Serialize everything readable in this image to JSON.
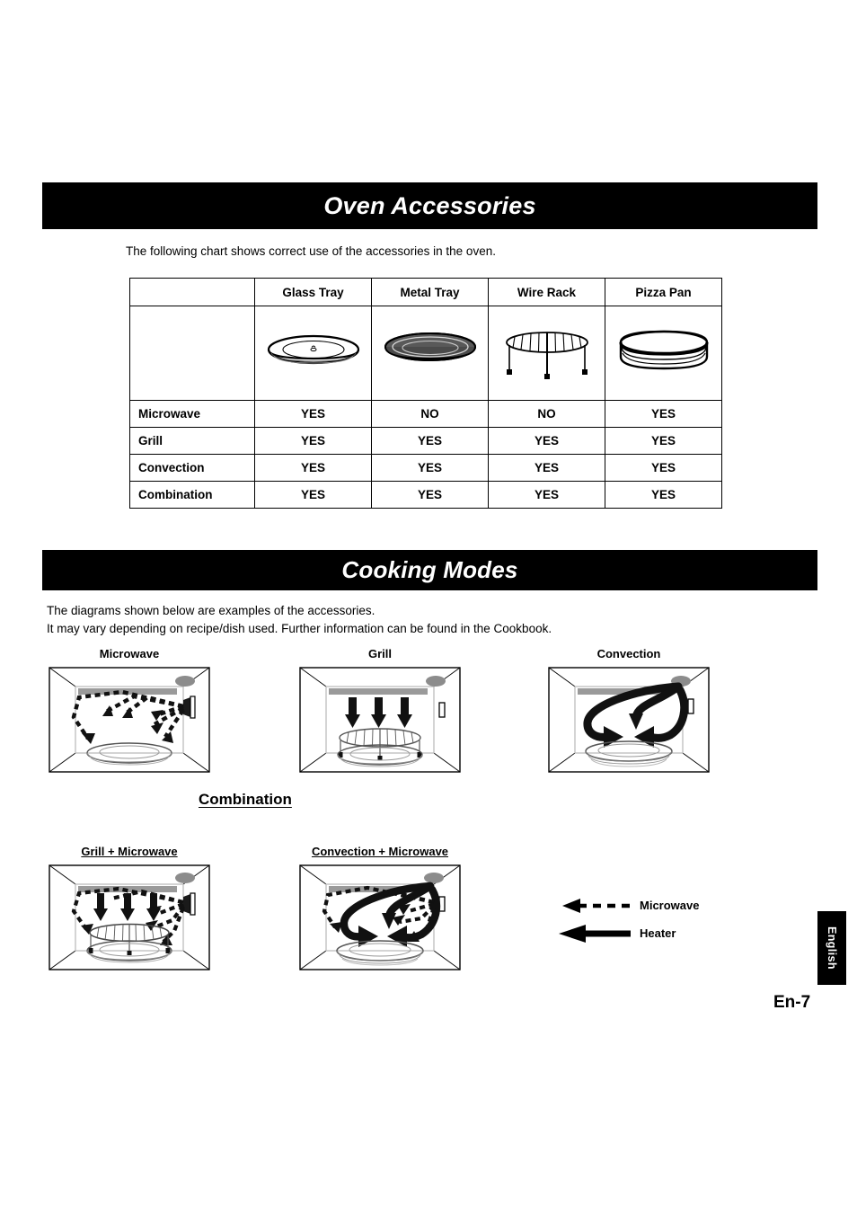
{
  "sections": {
    "accessories": {
      "title": "Oven Accessories",
      "intro": "The following chart shows correct use of the accessories in the oven."
    },
    "cooking": {
      "title": "Cooking Modes",
      "intro": "The diagrams shown below are examples of the accessories.\nIt may vary depending on recipe/dish used. Further information can be found in the Cookbook."
    }
  },
  "accessories_table": {
    "columns": [
      "",
      "Glass Tray",
      "Metal Tray",
      "Wire Rack",
      "Pizza Pan"
    ],
    "accessory_icons": [
      "glass-tray-icon",
      "metal-tray-icon",
      "wire-rack-icon",
      "pizza-pan-icon"
    ],
    "rows": [
      {
        "mode": "Microwave",
        "values": [
          "YES",
          "NO",
          "NO",
          "YES"
        ]
      },
      {
        "mode": "Grill",
        "values": [
          "YES",
          "YES",
          "YES",
          "YES"
        ]
      },
      {
        "mode": "Convection",
        "values": [
          "YES",
          "YES",
          "YES",
          "YES"
        ]
      },
      {
        "mode": "Combination",
        "values": [
          "YES",
          "YES",
          "YES",
          "YES"
        ]
      }
    ]
  },
  "cooking_modes": {
    "primary": [
      {
        "label": "Microwave",
        "diagram": "oven-microwave-diagram"
      },
      {
        "label": "Grill",
        "diagram": "oven-grill-diagram"
      },
      {
        "label": "Convection",
        "diagram": "oven-convection-diagram"
      }
    ],
    "combination_heading": "Combination",
    "combination": [
      {
        "label": "Grill + Microwave",
        "diagram": "oven-grill-microwave-diagram"
      },
      {
        "label": "Convection + Microwave",
        "diagram": "oven-convection-microwave-diagram"
      }
    ]
  },
  "legend": {
    "items": [
      {
        "label": "Microwave",
        "glyph": "dashed-arrow-icon"
      },
      {
        "label": "Heater",
        "glyph": "solid-arrow-icon"
      }
    ]
  },
  "footer": {
    "language_tab": "English",
    "page": "En-7"
  },
  "colors": {
    "banner_bg": "#000000",
    "banner_text": "#ffffff",
    "body_text": "#000000",
    "metal_tray_fill": "#5a5a5a",
    "heater_bar": "#9a9a9a",
    "lamp": "#8c8c8c"
  }
}
